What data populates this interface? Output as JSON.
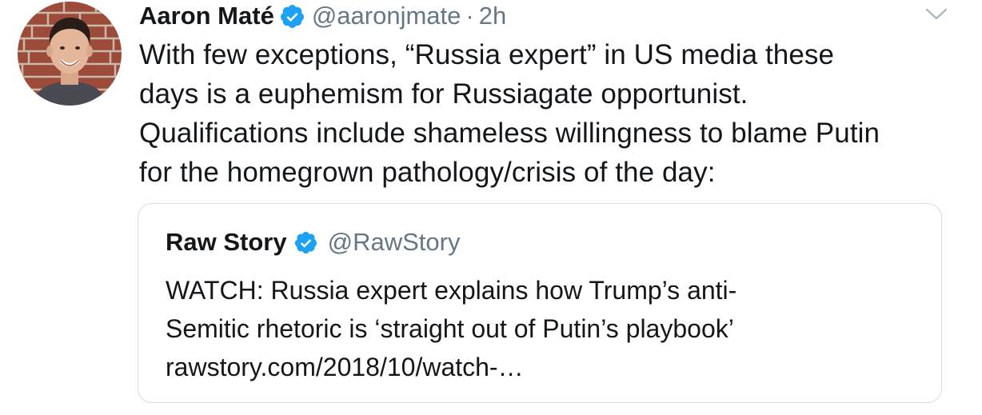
{
  "tweet": {
    "author": {
      "display_name": "Aaron Maté",
      "handle": "@aaronjmate",
      "verified": true
    },
    "separator": "·",
    "time": "2h",
    "caret_icon": "chevron-down-icon",
    "text_lines": [
      "With few exceptions, “Russia expert” in US media these",
      "days is a euphemism for Russiagate opportunist.",
      "Qualifications include shameless willingness to blame Putin",
      "for the homegrown pathology/crisis of the day:"
    ]
  },
  "quoted_tweet": {
    "author": {
      "display_name": "Raw Story",
      "handle": "@RawStory",
      "verified": true
    },
    "text_lines": [
      "WATCH: Russia expert explains how Trump’s anti-",
      "Semitic rhetoric is ‘straight out of Putin’s playbook’",
      "rawstory.com/2018/10/watch-…"
    ]
  },
  "colors": {
    "primary_text": "#14171a",
    "secondary_text": "#657786",
    "verified_badge": "#1da1f2",
    "quote_border": "#d5dde3"
  }
}
